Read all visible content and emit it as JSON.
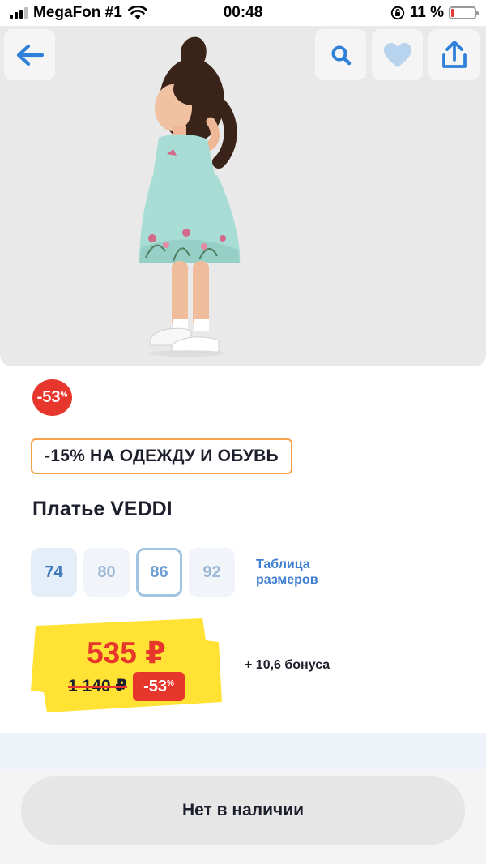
{
  "status_bar": {
    "carrier": "MegaFon #1",
    "time": "00:48",
    "battery": "11 %",
    "battery_level": 0.11
  },
  "hero": {
    "back_icon": "arrow-left-icon",
    "search_icon": "search-icon",
    "favorite_icon": "heart-icon",
    "share_icon": "share-icon",
    "image_alt": "child in mint dress"
  },
  "discount_badge": {
    "value": "-53",
    "unit": "%"
  },
  "promo_label": "-15% НА ОДЕЖДУ И ОБУВЬ",
  "product": {
    "title": "Платье VEDDI"
  },
  "sizes": {
    "items": [
      {
        "label": "74",
        "state": "available"
      },
      {
        "label": "80",
        "state": "unavailable"
      },
      {
        "label": "86",
        "state": "selected"
      },
      {
        "label": "92",
        "state": "unavailable"
      }
    ],
    "table_link": "Таблица размеров"
  },
  "price": {
    "current": "535 ₽",
    "old": "1 140 ₽",
    "discount": "-53",
    "discount_unit": "%",
    "bonus": "+ 10,6 бонуса"
  },
  "cta": {
    "label": "Нет в наличии"
  },
  "colors": {
    "accent_red": "#e7362c",
    "accent_blue": "#3f7fd1",
    "promo_border": "#f5a34a",
    "price_yellow": "#ffe234"
  }
}
